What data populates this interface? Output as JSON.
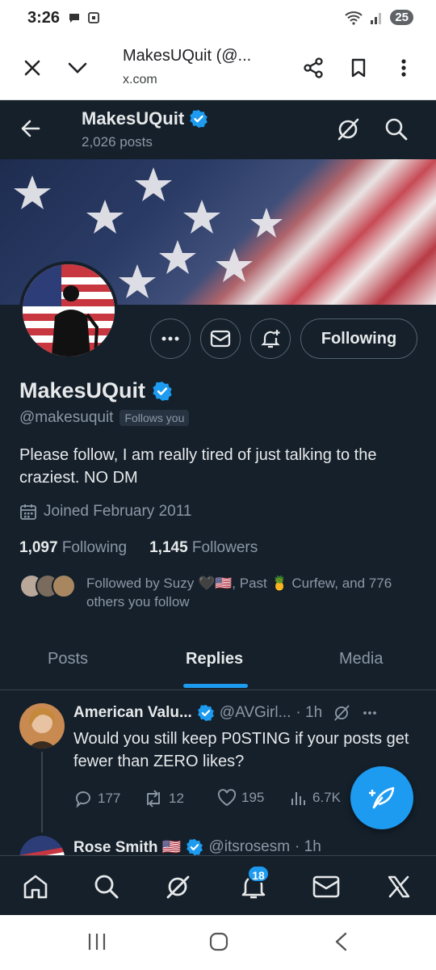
{
  "status_bar": {
    "time": "3:26",
    "battery": "25"
  },
  "browser": {
    "page_title": "MakesUQuit (@...",
    "url": "x.com"
  },
  "header": {
    "name": "MakesUQuit",
    "posts_count": "2,026 posts"
  },
  "profile": {
    "display_name": "MakesUQuit",
    "handle": "@makesuquit",
    "follows_you": "Follows you",
    "following_button": "Following",
    "bio": "Please follow, I am really tired of just talking to the craziest. NO DM",
    "joined": "Joined February 2011",
    "following_count": "1,097",
    "following_label": "Following",
    "followers_count": "1,145",
    "followers_label": "Followers",
    "followed_by": "Followed by Suzy 🖤🇺🇸, Past 🍍 Curfew, and 776 others you follow"
  },
  "tabs": [
    "Posts",
    "Replies",
    "Media"
  ],
  "active_tab": "Replies",
  "tweets": [
    {
      "name": "American Valu...",
      "handle": "@AVGirl...",
      "time": "· 1h",
      "text": "Would you still keep P0STING if your posts get fewer than ZERO likes?",
      "replies": "177",
      "reposts": "12",
      "likes": "195",
      "views": "6.7K"
    },
    {
      "name": "Rose Smith 🇺🇸",
      "handle": "@itsrosesm",
      "time": "· 1h"
    }
  ],
  "bottom_nav": {
    "notifications_badge": "18"
  },
  "colors": {
    "bg": "#15202b",
    "accent": "#1d9bf0",
    "muted": "#8b98a5",
    "text": "#e7e9ea"
  }
}
